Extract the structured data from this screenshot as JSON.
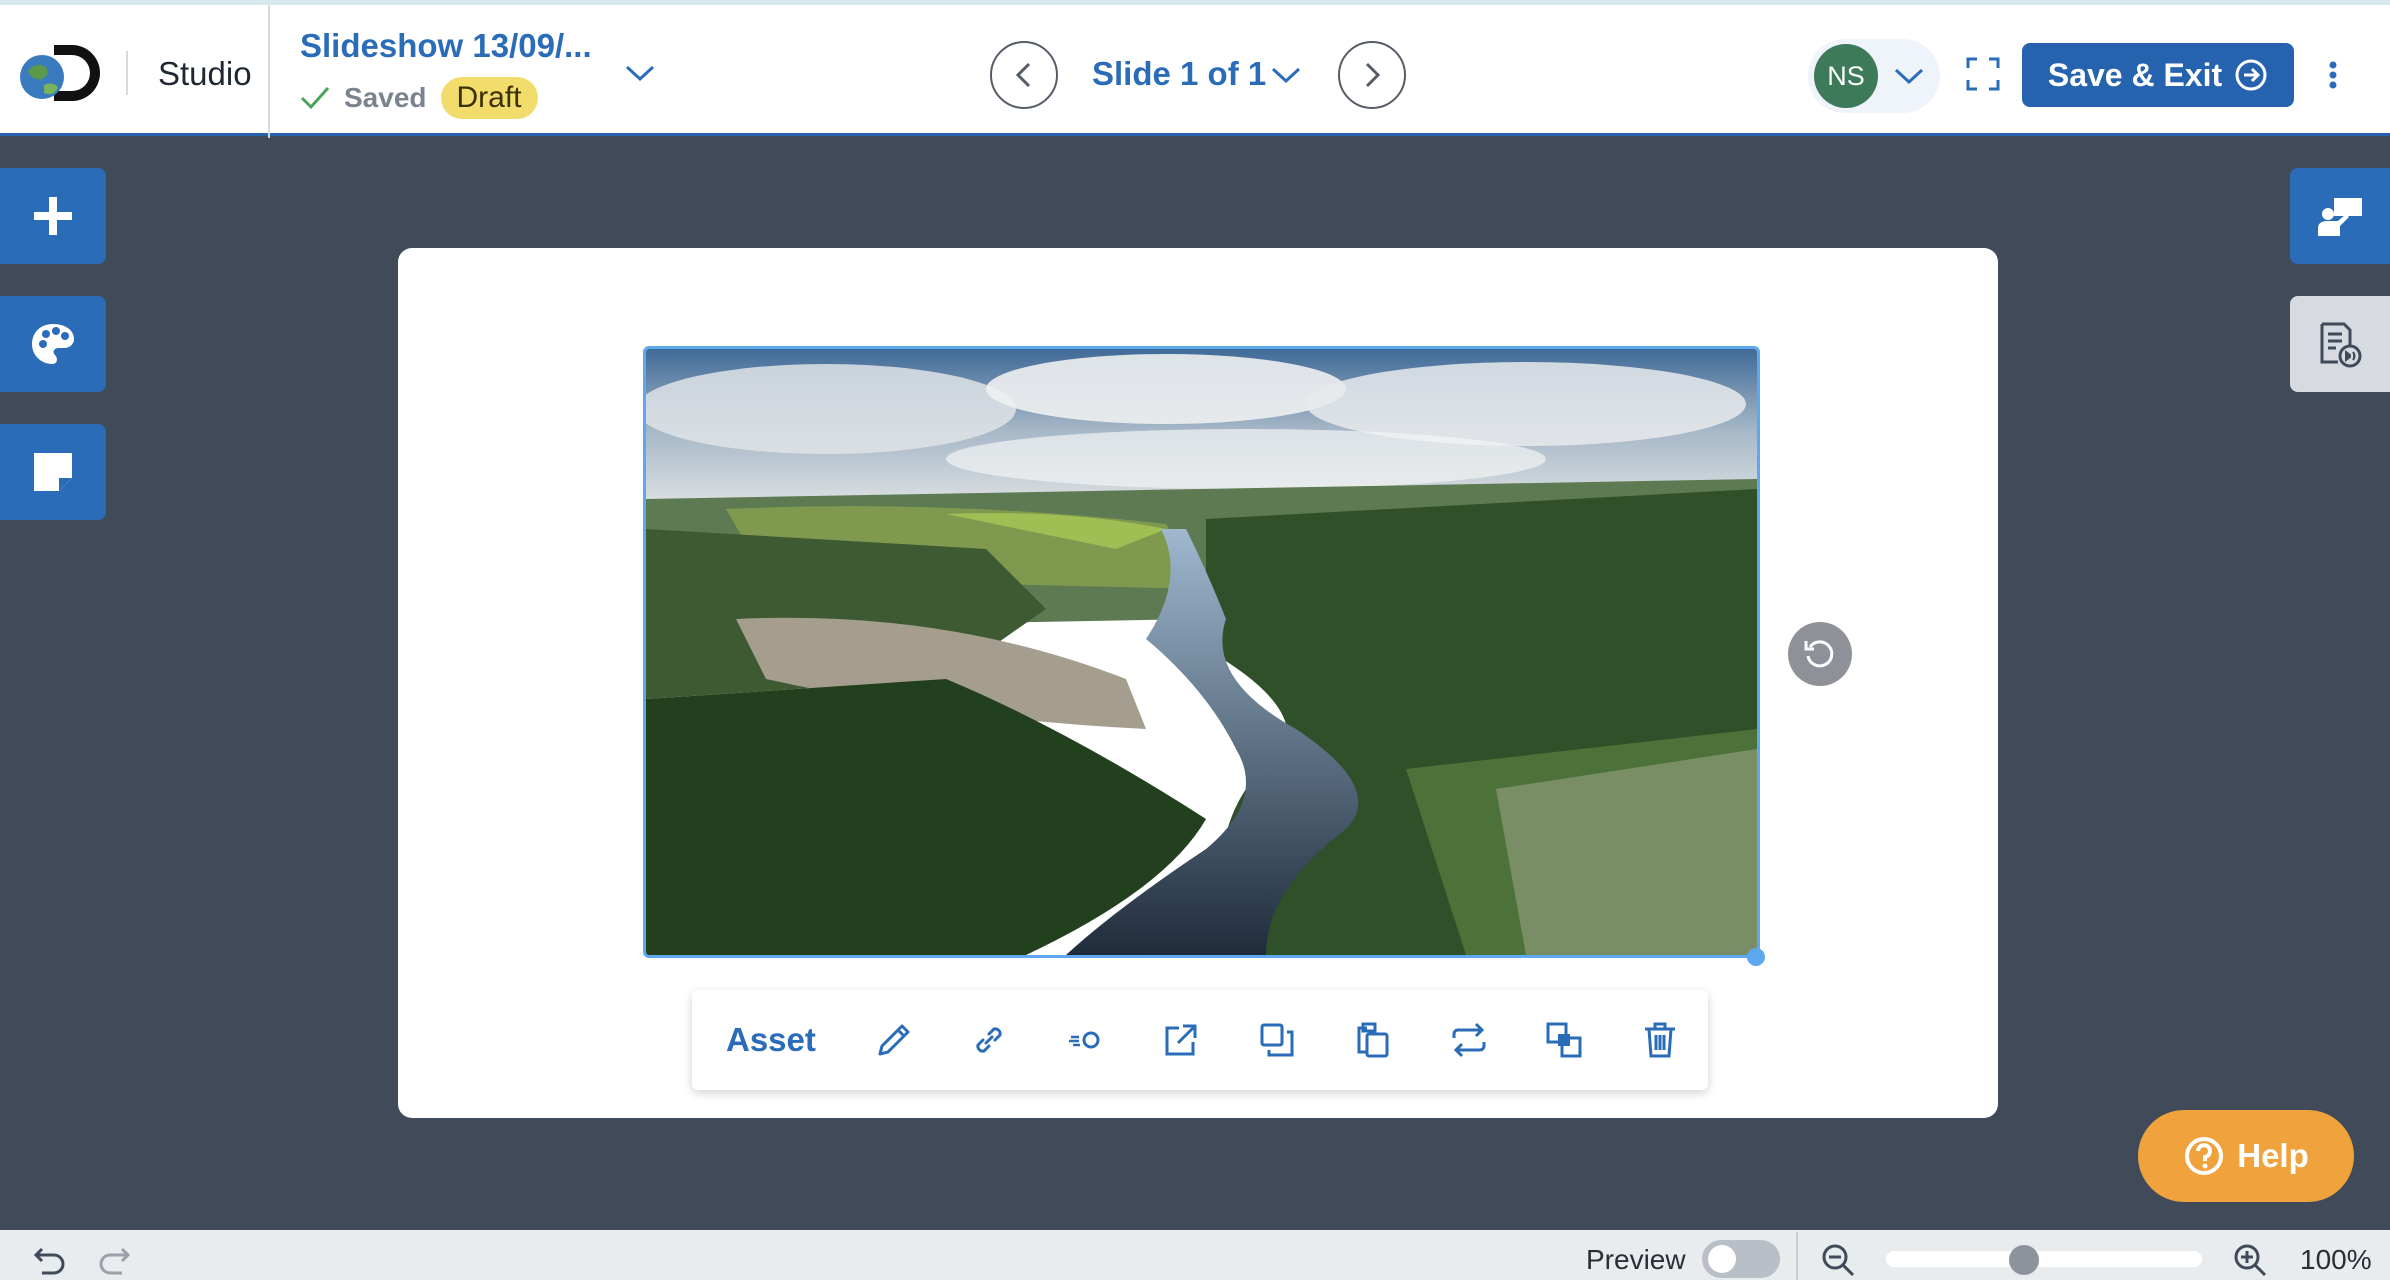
{
  "header": {
    "studio_label": "Studio",
    "slideshow_title": "Slideshow 13/09/...",
    "saved_label": "Saved",
    "draft_badge": "Draft",
    "slide_indicator": "Slide 1 of 1",
    "user_initials": "NS",
    "save_exit_label": "Save & Exit"
  },
  "left_tools": [
    "add",
    "theme",
    "notes"
  ],
  "right_tools": [
    "present",
    "audio-script"
  ],
  "toolbar": {
    "asset_label": "Asset",
    "icons": [
      "edit",
      "link",
      "animation",
      "open-external",
      "duplicate",
      "copy",
      "replace",
      "arrange",
      "delete"
    ]
  },
  "help_label": "Help",
  "footer": {
    "preview_label": "Preview",
    "preview_on": false,
    "zoom_value": "100%",
    "zoom_level": 0.43
  },
  "colors": {
    "accent": "#2563ae",
    "canvas_bg": "#414a59",
    "draft": "#f2dc6c",
    "help": "#f0a23d"
  }
}
